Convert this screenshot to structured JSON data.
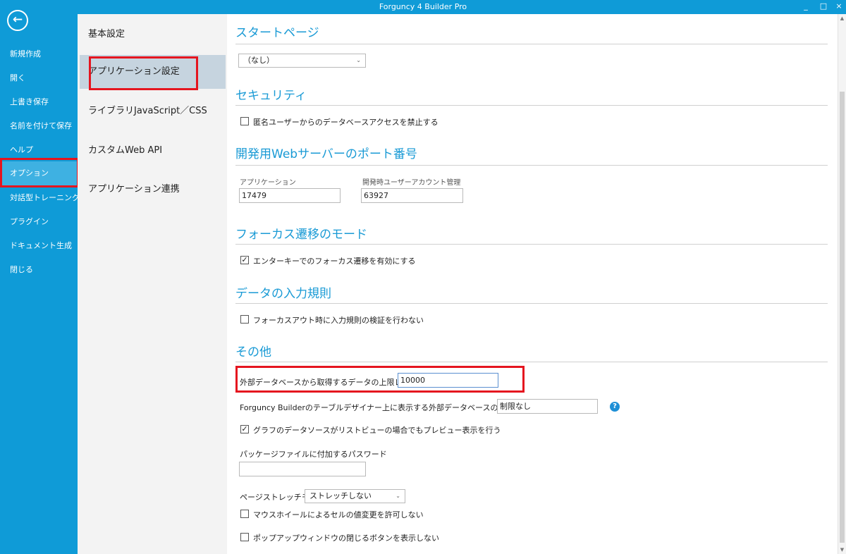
{
  "app": {
    "title": "Forguncy 4 Builder Pro",
    "minimize_glyph": "_",
    "maximize_glyph": "□",
    "close_glyph": "×"
  },
  "nav": {
    "back_glyph": "←",
    "items": [
      "新規作成",
      "開く",
      "上書き保存",
      "名前を付けて保存",
      "ヘルプ",
      "オプション",
      "対話型トレーニング",
      "プラグイン",
      "ドキュメント生成",
      "閉じる"
    ],
    "selected": "オプション"
  },
  "categories": {
    "items": [
      "基本設定",
      "アプリケーション設定",
      "ライブラリJavaScript／CSS",
      "カスタムWeb API",
      "アプリケーション連携"
    ],
    "selected": "アプリケーション設定"
  },
  "settings": {
    "start_page": {
      "heading": "スタートページ",
      "value": "（なし）"
    },
    "security": {
      "heading": "セキュリティ",
      "anon_db_access_label": "匿名ユーザーからのデータベースアクセスを禁止する",
      "anon_db_access_checked": false
    },
    "ports": {
      "heading": "開発用Webサーバーのポート番号",
      "app_label": "アプリケーション",
      "app_value": "17479",
      "account_label": "開発時ユーザーアカウント管理",
      "account_value": "63927"
    },
    "focus": {
      "heading": "フォーカス遷移のモード",
      "enter_key_label": "エンターキーでのフォーカス遷移を有効にする",
      "enter_key_checked": true
    },
    "validation": {
      "heading": "データの入力規則",
      "skip_label": "フォーカスアウト時に入力規則の検証を行わない",
      "skip_checked": false
    },
    "other": {
      "heading": "その他",
      "record_limit_label": "外部データベースから取得するデータの上限レコード数",
      "record_limit_value": "10000",
      "designer_limit_label": "Forguncy Builderのテーブルデザイナー上に表示する外部データベースの上限レコード数",
      "designer_limit_value": "制限なし",
      "help_glyph": "?",
      "chart_preview_label": "グラフのデータソースがリストビューの場合でもプレビュー表示を行う",
      "chart_preview_checked": true,
      "package_password_label": "パッケージファイルに付加するパスワード",
      "package_password_value": "",
      "stretch_label": "ページストレッチモード",
      "stretch_value": "ストレッチしない",
      "mouse_wheel_label": "マウスホイールによるセルの値変更を許可しない",
      "mouse_wheel_checked": false,
      "popup_close_label": "ポップアップウィンドウの閉じるボタンを表示しない",
      "popup_close_checked": false
    }
  },
  "colors": {
    "nav_bg": "#0f9bd7",
    "nav_selected": "#3eb1e2",
    "heading": "#199ad5",
    "highlight_box": "#e5151f",
    "category_selected": "#c6d4df"
  },
  "check_glyph": "✓",
  "chevron_glyph": "⌄"
}
